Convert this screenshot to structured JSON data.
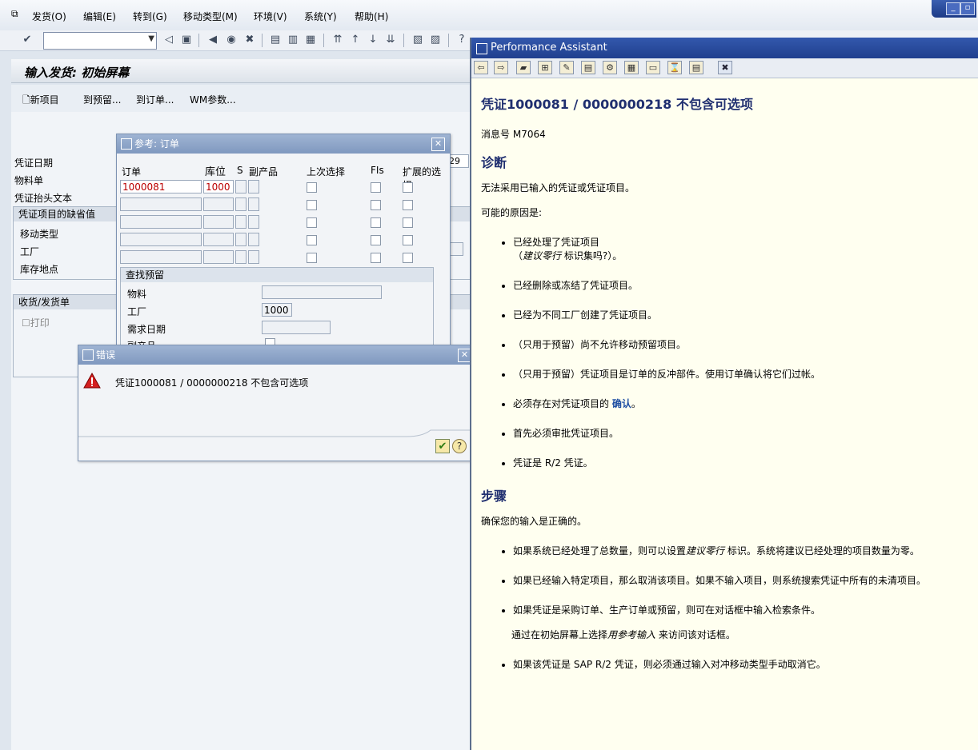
{
  "menu": {
    "items": [
      "发货(O)",
      "编辑(E)",
      "转到(G)",
      "移动类型(M)",
      "环境(V)",
      "系统(Y)",
      "帮助(H)"
    ]
  },
  "window_controls": {
    "minimize": "_",
    "restore": "▫"
  },
  "screen": {
    "title": "输入发货: 初始屏幕",
    "app_toolbar": {
      "new_item": "新项目",
      "to_reservation": "到预留...",
      "to_order": "到订单...",
      "wm_params": "WM参数..."
    },
    "fields": {
      "doc_date": "凭证日期",
      "material_slip": "物料单",
      "header_text": "凭证抬头文本",
      "date_suffix": "29"
    },
    "defaults_group": {
      "title": "凭证项目的缺省值",
      "movement_type": "移动类型",
      "plant": "工厂",
      "storage_location": "库存地点"
    },
    "gr_slip_group": {
      "title": "收货/发货单",
      "print": "打印"
    }
  },
  "ref_dialog": {
    "title": "参考: 订单",
    "columns": {
      "order": "订单",
      "sloc": "库位",
      "s": "S",
      "byproduct": "副产品",
      "last_sel": "上次选择",
      "fis": "FIs",
      "ext_sel": "扩展的选择"
    },
    "rows": [
      {
        "order": "1000081",
        "sloc": "1000"
      },
      {
        "order": "",
        "sloc": ""
      },
      {
        "order": "",
        "sloc": ""
      },
      {
        "order": "",
        "sloc": ""
      },
      {
        "order": "",
        "sloc": ""
      }
    ],
    "find_reservation": {
      "title": "查找预留",
      "material": "物料",
      "plant": "工厂",
      "plant_value": "1000",
      "req_date": "需求日期",
      "byproduct": "副产品"
    }
  },
  "error_dialog": {
    "title": "错误",
    "message": "凭证1000081 / 0000000218 不包含可选项"
  },
  "performance_assistant": {
    "title": "Performance Assistant",
    "heading": "凭证1000081 / 0000000218 不包含可选项",
    "message_no_label": "消息号",
    "message_no": "M7064",
    "diagnosis_title": "诊断",
    "diagnosis_text": "无法采用已输入的凭证或凭证项目。",
    "possible_causes": "可能的原因是:",
    "causes": [
      {
        "text": "已经处理了凭证项目",
        "sub_pre": "（",
        "sub_em": "建议零行",
        "sub_post": " 标识集吗?）。"
      },
      {
        "text": "已经删除或冻结了凭证项目。"
      },
      {
        "text": "已经为不同工厂创建了凭证项目。"
      },
      {
        "text": "（只用于预留）尚不允许移动预留项目。"
      },
      {
        "text": "（只用于预留）凭证项目是订单的反冲部件。使用订单确认将它们过帐。"
      },
      {
        "text_pre": "必须存在对凭证项目的 ",
        "link": "确认",
        "text_post": "。"
      },
      {
        "text": "首先必须审批凭证项目。"
      },
      {
        "text": "凭证是 R/2 凭证。"
      }
    ],
    "procedure_title": "步骤",
    "procedure_text": "确保您的输入是正确的。",
    "steps": [
      {
        "pre": "如果系统已经处理了总数量，则可以设置",
        "em": "建议零行",
        "post": " 标识。系统将建议已经处理的项目数量为零。"
      },
      {
        "pre": "如果已经输入特定项目，那么取消该项目。如果不输入项目，则系统搜索凭证中所有的未清项目。"
      },
      {
        "pre": "如果凭证是采购订单、生产订单或预留，则可在对话框中输入检索条件。",
        "sub_pre": "通过在初始屏幕上选择",
        "sub_em": "用参考输入",
        "sub_post": " 来访问该对话框。"
      },
      {
        "pre": "如果该凭证是 SAP R/2 凭证，则必须通过输入对冲移动类型手动取消它。"
      }
    ]
  }
}
